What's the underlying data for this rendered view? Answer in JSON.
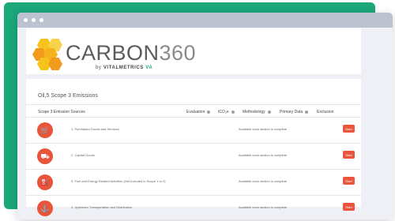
{
  "logo": {
    "word": "CARBON",
    "number": "360",
    "by": "by",
    "company": "VITALMETRICS",
    "mark": "VA"
  },
  "section": {
    "title": "Oil,5 Scope 3 Emissions"
  },
  "columns": {
    "source": "Scope 3 Emission Sources",
    "evaluation": "Evaluation",
    "tco2e": "tCO₂e",
    "methodology": "Methodology",
    "primary_data": "Primary Data",
    "exclusion": "Exclusion"
  },
  "rows": [
    {
      "label": "1. Purchased Goods and Services",
      "status": "Available once section is complete",
      "button": "Start",
      "icon": "cart-icon"
    },
    {
      "label": "2. Capital Goods",
      "status": "Available once section is complete",
      "button": "Start",
      "icon": "truck-icon"
    },
    {
      "label": "3. Fuel and Energy Related Activities (Not Included in Scope 1 or 2)",
      "status": "Available once section is complete",
      "button": "Start",
      "icon": "fuel-icon"
    },
    {
      "label": "4. Upstream Transportation and Distribution",
      "status": "Available once section is complete",
      "button": "Start",
      "icon": "transport-icon"
    }
  ],
  "colors": {
    "green": "#1aa77a",
    "accent": "#e8553b",
    "hex_yellow": "#f6c21b",
    "hex_orange": "#f29a1e"
  }
}
